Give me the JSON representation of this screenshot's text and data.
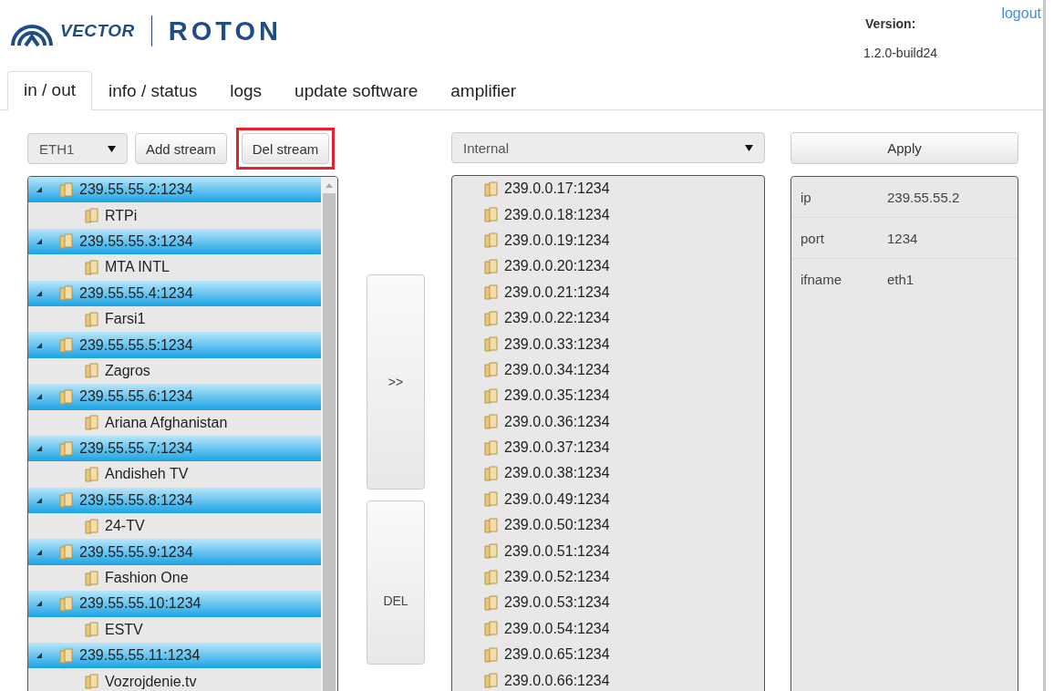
{
  "header": {
    "brand": "VECTOR",
    "product": "ROTON",
    "version_label": "Version:",
    "version": "1.2.0-build24",
    "logout": "logout"
  },
  "tabs": [
    {
      "label": "in / out",
      "selected": true
    },
    {
      "label": "info / status",
      "selected": false
    },
    {
      "label": "logs",
      "selected": false
    },
    {
      "label": "update software",
      "selected": false
    },
    {
      "label": "amplifier",
      "selected": false
    }
  ],
  "toolbar": {
    "interface": "ETH1",
    "buttons": [
      {
        "label": "Add stream",
        "highlighted": false
      },
      {
        "label": "Del stream",
        "highlighted": true
      }
    ]
  },
  "streams": [
    {
      "label": "239.55.55.2:1234",
      "expanded": true,
      "children": [
        {
          "label": "RTPi"
        }
      ]
    },
    {
      "label": "239.55.55.3:1234",
      "expanded": true,
      "children": [
        {
          "label": "MTA INTL"
        }
      ]
    },
    {
      "label": "239.55.55.4:1234",
      "expanded": true,
      "children": [
        {
          "label": "Farsi1"
        }
      ]
    },
    {
      "label": "239.55.55.5:1234",
      "expanded": true,
      "children": [
        {
          "label": "Zagros"
        }
      ]
    },
    {
      "label": "239.55.55.6:1234",
      "expanded": true,
      "children": [
        {
          "label": "Ariana Afghanistan"
        }
      ]
    },
    {
      "label": "239.55.55.7:1234",
      "expanded": true,
      "children": [
        {
          "label": "Andisheh TV"
        }
      ]
    },
    {
      "label": "239.55.55.8:1234",
      "expanded": true,
      "children": [
        {
          "label": "24-TV"
        }
      ]
    },
    {
      "label": "239.55.55.9:1234",
      "expanded": true,
      "children": [
        {
          "label": "Fashion One"
        }
      ]
    },
    {
      "label": "239.55.55.10:1234",
      "expanded": true,
      "children": [
        {
          "label": "ESTV"
        }
      ]
    },
    {
      "label": "239.55.55.11:1234",
      "expanded": true,
      "children": [
        {
          "label": "Vozrojdenie.tv"
        }
      ]
    }
  ],
  "middle_buttons": [
    ">>",
    "DEL"
  ],
  "target": {
    "select": "Internal",
    "items": [
      "239.0.0.17:1234",
      "239.0.0.18:1234",
      "239.0.0.19:1234",
      "239.0.0.20:1234",
      "239.0.0.21:1234",
      "239.0.0.22:1234",
      "239.0.0.33:1234",
      "239.0.0.34:1234",
      "239.0.0.35:1234",
      "239.0.0.36:1234",
      "239.0.0.37:1234",
      "239.0.0.38:1234",
      "239.0.0.49:1234",
      "239.0.0.50:1234",
      "239.0.0.51:1234",
      "239.0.0.52:1234",
      "239.0.0.53:1234",
      "239.0.0.54:1234",
      "239.0.0.65:1234",
      "239.0.0.66:1234"
    ]
  },
  "properties": {
    "apply": "Apply",
    "rows": [
      {
        "key": "ip",
        "value": "239.55.55.2"
      },
      {
        "key": "port",
        "value": "1234"
      },
      {
        "key": "ifname",
        "value": "eth1"
      }
    ]
  }
}
